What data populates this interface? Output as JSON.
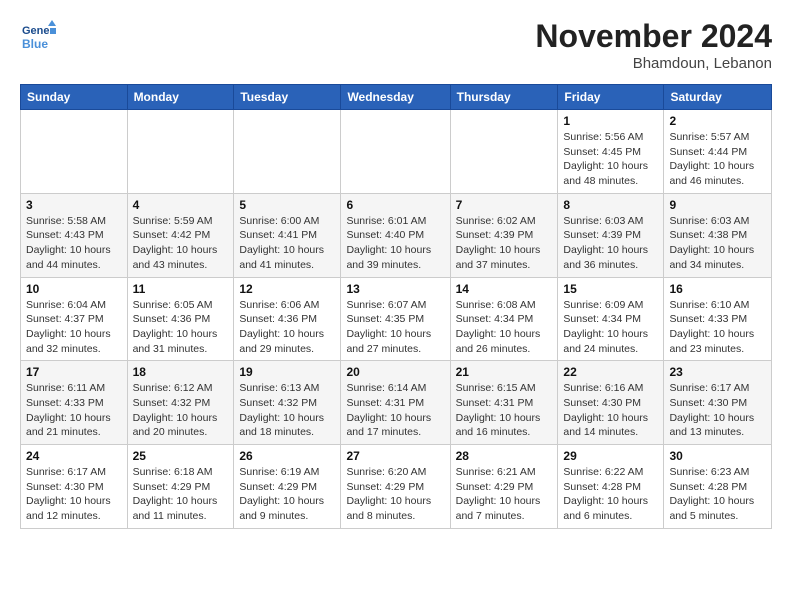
{
  "header": {
    "logo_line1": "General",
    "logo_line2": "Blue",
    "month": "November 2024",
    "location": "Bhamdoun, Lebanon"
  },
  "weekdays": [
    "Sunday",
    "Monday",
    "Tuesday",
    "Wednesday",
    "Thursday",
    "Friday",
    "Saturday"
  ],
  "weeks": [
    [
      {
        "day": "",
        "info": ""
      },
      {
        "day": "",
        "info": ""
      },
      {
        "day": "",
        "info": ""
      },
      {
        "day": "",
        "info": ""
      },
      {
        "day": "",
        "info": ""
      },
      {
        "day": "1",
        "info": "Sunrise: 5:56 AM\nSunset: 4:45 PM\nDaylight: 10 hours\nand 48 minutes."
      },
      {
        "day": "2",
        "info": "Sunrise: 5:57 AM\nSunset: 4:44 PM\nDaylight: 10 hours\nand 46 minutes."
      }
    ],
    [
      {
        "day": "3",
        "info": "Sunrise: 5:58 AM\nSunset: 4:43 PM\nDaylight: 10 hours\nand 44 minutes."
      },
      {
        "day": "4",
        "info": "Sunrise: 5:59 AM\nSunset: 4:42 PM\nDaylight: 10 hours\nand 43 minutes."
      },
      {
        "day": "5",
        "info": "Sunrise: 6:00 AM\nSunset: 4:41 PM\nDaylight: 10 hours\nand 41 minutes."
      },
      {
        "day": "6",
        "info": "Sunrise: 6:01 AM\nSunset: 4:40 PM\nDaylight: 10 hours\nand 39 minutes."
      },
      {
        "day": "7",
        "info": "Sunrise: 6:02 AM\nSunset: 4:39 PM\nDaylight: 10 hours\nand 37 minutes."
      },
      {
        "day": "8",
        "info": "Sunrise: 6:03 AM\nSunset: 4:39 PM\nDaylight: 10 hours\nand 36 minutes."
      },
      {
        "day": "9",
        "info": "Sunrise: 6:03 AM\nSunset: 4:38 PM\nDaylight: 10 hours\nand 34 minutes."
      }
    ],
    [
      {
        "day": "10",
        "info": "Sunrise: 6:04 AM\nSunset: 4:37 PM\nDaylight: 10 hours\nand 32 minutes."
      },
      {
        "day": "11",
        "info": "Sunrise: 6:05 AM\nSunset: 4:36 PM\nDaylight: 10 hours\nand 31 minutes."
      },
      {
        "day": "12",
        "info": "Sunrise: 6:06 AM\nSunset: 4:36 PM\nDaylight: 10 hours\nand 29 minutes."
      },
      {
        "day": "13",
        "info": "Sunrise: 6:07 AM\nSunset: 4:35 PM\nDaylight: 10 hours\nand 27 minutes."
      },
      {
        "day": "14",
        "info": "Sunrise: 6:08 AM\nSunset: 4:34 PM\nDaylight: 10 hours\nand 26 minutes."
      },
      {
        "day": "15",
        "info": "Sunrise: 6:09 AM\nSunset: 4:34 PM\nDaylight: 10 hours\nand 24 minutes."
      },
      {
        "day": "16",
        "info": "Sunrise: 6:10 AM\nSunset: 4:33 PM\nDaylight: 10 hours\nand 23 minutes."
      }
    ],
    [
      {
        "day": "17",
        "info": "Sunrise: 6:11 AM\nSunset: 4:33 PM\nDaylight: 10 hours\nand 21 minutes."
      },
      {
        "day": "18",
        "info": "Sunrise: 6:12 AM\nSunset: 4:32 PM\nDaylight: 10 hours\nand 20 minutes."
      },
      {
        "day": "19",
        "info": "Sunrise: 6:13 AM\nSunset: 4:32 PM\nDaylight: 10 hours\nand 18 minutes."
      },
      {
        "day": "20",
        "info": "Sunrise: 6:14 AM\nSunset: 4:31 PM\nDaylight: 10 hours\nand 17 minutes."
      },
      {
        "day": "21",
        "info": "Sunrise: 6:15 AM\nSunset: 4:31 PM\nDaylight: 10 hours\nand 16 minutes."
      },
      {
        "day": "22",
        "info": "Sunrise: 6:16 AM\nSunset: 4:30 PM\nDaylight: 10 hours\nand 14 minutes."
      },
      {
        "day": "23",
        "info": "Sunrise: 6:17 AM\nSunset: 4:30 PM\nDaylight: 10 hours\nand 13 minutes."
      }
    ],
    [
      {
        "day": "24",
        "info": "Sunrise: 6:17 AM\nSunset: 4:30 PM\nDaylight: 10 hours\nand 12 minutes."
      },
      {
        "day": "25",
        "info": "Sunrise: 6:18 AM\nSunset: 4:29 PM\nDaylight: 10 hours\nand 11 minutes."
      },
      {
        "day": "26",
        "info": "Sunrise: 6:19 AM\nSunset: 4:29 PM\nDaylight: 10 hours\nand 9 minutes."
      },
      {
        "day": "27",
        "info": "Sunrise: 6:20 AM\nSunset: 4:29 PM\nDaylight: 10 hours\nand 8 minutes."
      },
      {
        "day": "28",
        "info": "Sunrise: 6:21 AM\nSunset: 4:29 PM\nDaylight: 10 hours\nand 7 minutes."
      },
      {
        "day": "29",
        "info": "Sunrise: 6:22 AM\nSunset: 4:28 PM\nDaylight: 10 hours\nand 6 minutes."
      },
      {
        "day": "30",
        "info": "Sunrise: 6:23 AM\nSunset: 4:28 PM\nDaylight: 10 hours\nand 5 minutes."
      }
    ]
  ]
}
